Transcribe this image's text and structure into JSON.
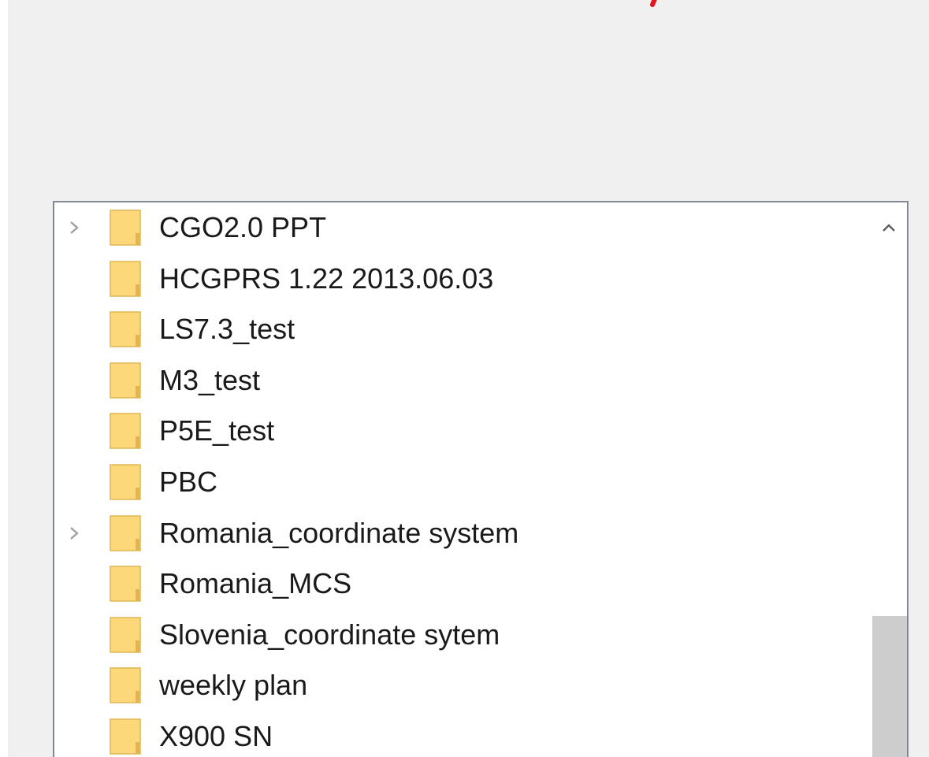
{
  "folder_tree": {
    "items": [
      {
        "label": "CGO2.0 PPT",
        "expandable": true
      },
      {
        "label": "HCGPRS 1.22 2013.06.03",
        "expandable": false
      },
      {
        "label": "LS7.3_test",
        "expandable": false
      },
      {
        "label": "M3_test",
        "expandable": false
      },
      {
        "label": "P5E_test",
        "expandable": false
      },
      {
        "label": "PBC",
        "expandable": false
      },
      {
        "label": "Romania_coordinate system",
        "expandable": true
      },
      {
        "label": "Romania_MCS",
        "expandable": false
      },
      {
        "label": "Slovenia_coordinate sytem",
        "expandable": false
      },
      {
        "label": "weekly plan",
        "expandable": false
      },
      {
        "label": "X900 SN",
        "expandable": false
      }
    ],
    "expander_icon": "chevron-right-icon",
    "item_icon": "folder-icon"
  },
  "scrollbar": {
    "up_icon": "chevron-up-icon"
  },
  "colors": {
    "dialog_background": "#f0f0f0",
    "tree_background": "#ffffff",
    "tree_border": "#828790",
    "folder_fill": "#fcd87a",
    "folder_edge": "#e0b552",
    "text": "#1a1a1a",
    "scroll_thumb": "#cdcdcd",
    "annotation_mark": "#e8141c"
  }
}
